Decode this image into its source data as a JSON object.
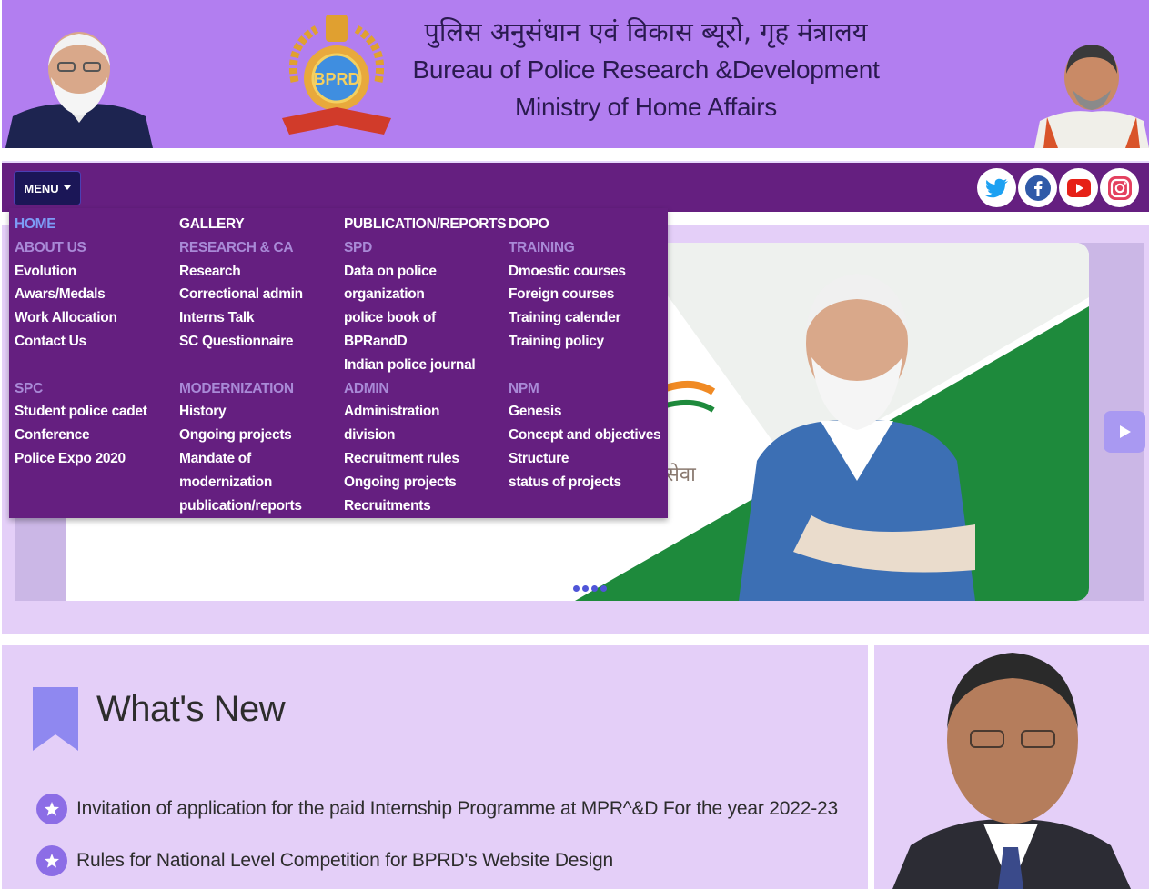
{
  "header": {
    "title_hindi": "पुलिस अनुसंधान एवं विकास ब्यूरो, गृह मंत्रालय",
    "title_en_line1": "Bureau of Police Research &Development",
    "title_en_line2": "Ministry of Home Affairs",
    "emblem_text": "BPRD",
    "bg_color": "#b27ef0"
  },
  "navbar": {
    "menu_label": "MENU",
    "bg_color": "#651f80",
    "social": [
      "twitter-icon",
      "facebook-icon",
      "youtube-icon",
      "instagram-icon"
    ]
  },
  "mega_menu": {
    "columns": [
      {
        "groups": [
          {
            "heading": "HOME",
            "items": []
          },
          {
            "heading": "ABOUT US",
            "items": [
              "Evolution",
              "Awars/Medals",
              "Work Allocation",
              "Contact Us"
            ]
          },
          {
            "heading": "SPC",
            "items": [
              "Student police cadet",
              "Conference",
              "Police Expo 2020"
            ]
          }
        ]
      },
      {
        "groups": [
          {
            "heading": "GALLERY",
            "items": []
          },
          {
            "heading": "RESEARCH & CA",
            "items": [
              "Research",
              "Correctional admin",
              "Interns Talk",
              "SC Questionnaire"
            ]
          },
          {
            "heading": "MODERNIZATION",
            "items": [
              "History",
              "Ongoing projects",
              "Mandate of",
              "modernization",
              "publication/reports"
            ]
          }
        ]
      },
      {
        "groups": [
          {
            "heading": "PUBLICATION/REPORTS",
            "items": []
          },
          {
            "heading": "SPD",
            "items": [
              "Data on police",
              "organization",
              "police book of",
              "BPRandD",
              "Indian police journal"
            ]
          },
          {
            "heading": "ADMIN",
            "items": [
              "Administration",
              "division",
              "Recruitment rules",
              "Ongoing projects",
              "Recruitments"
            ]
          }
        ]
      },
      {
        "groups": [
          {
            "heading": "DOPO",
            "items": []
          },
          {
            "heading": "TRAINING",
            "items": [
              "Dmoestic courses",
              "Foreign courses",
              "Training calender",
              "Training policy"
            ]
          },
          {
            "heading": "NPM",
            "items": [
              "Genesis",
              "Concept and objectives",
              "Structure",
              "status of projects"
            ]
          }
        ]
      }
    ]
  },
  "slider": {
    "slide_text": "सेवा",
    "dot_count": 4
  },
  "whats_new": {
    "title": "What's New",
    "items": [
      "Invitation of application for the paid Internship Programme at MPR^&D For the year 2022-23",
      "Rules for National Level Competition for BPRD's Website Design"
    ]
  },
  "colors": {
    "accent": "#8c6de6",
    "panel_bg": "#e4cff8",
    "menu_heading": "#a98ad7",
    "menu_active": "#7d9cf6"
  }
}
